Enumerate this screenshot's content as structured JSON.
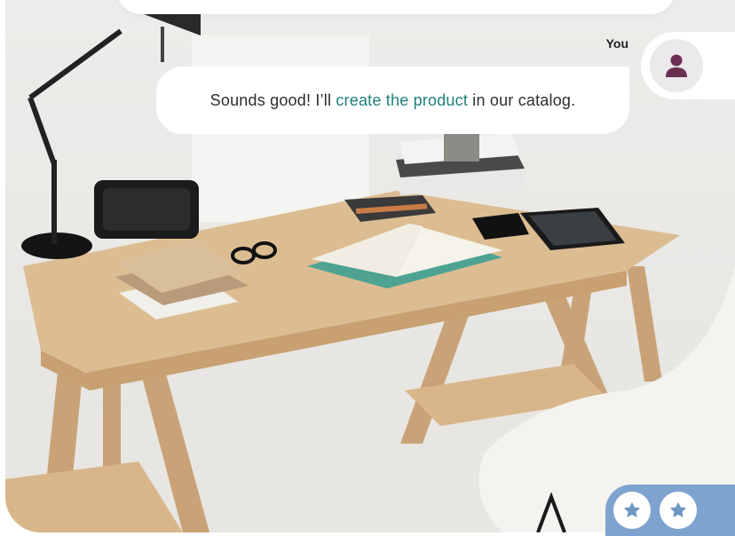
{
  "conversation": {
    "sender_label": "You",
    "message": {
      "before_link": "Sounds good! I’ll ",
      "link_text": "create the product",
      "after_link": " in our catalog."
    }
  },
  "colors": {
    "link": "#1d7f7a",
    "avatar_icon": "#6b2f52",
    "rating_bar": "#7ea3cf",
    "star": "#6f97c4"
  },
  "icons": {
    "avatar": "user-icon",
    "star": "star-icon"
  }
}
